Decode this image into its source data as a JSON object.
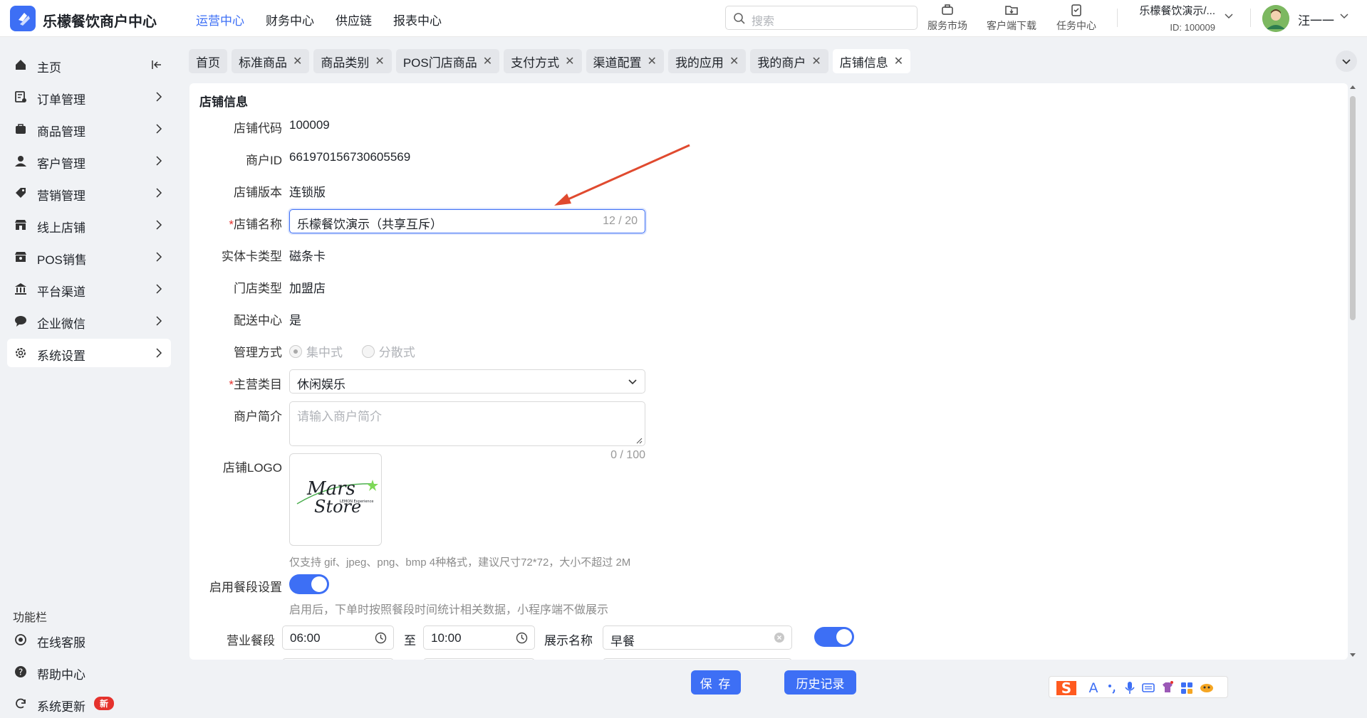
{
  "header": {
    "brand": "乐檬餐饮商户中心",
    "nav": [
      "运营中心",
      "财务中心",
      "供应链",
      "报表中心"
    ],
    "active_nav": 0,
    "search_placeholder": "搜索",
    "tools": [
      "服务市场",
      "客户端下载",
      "任务中心"
    ],
    "merchant_name": "乐檬餐饮演示/...",
    "merchant_id": "ID: 100009",
    "username": "汪一一"
  },
  "sidebar": {
    "items": [
      {
        "label": "主页",
        "icon": "home-icon"
      },
      {
        "label": "订单管理",
        "icon": "order-icon"
      },
      {
        "label": "商品管理",
        "icon": "goods-icon"
      },
      {
        "label": "客户管理",
        "icon": "user-icon"
      },
      {
        "label": "营销管理",
        "icon": "tag-icon"
      },
      {
        "label": "线上店铺",
        "icon": "store-icon"
      },
      {
        "label": "POS销售",
        "icon": "pos-icon"
      },
      {
        "label": "平台渠道",
        "icon": "bank-icon"
      },
      {
        "label": "企业微信",
        "icon": "chat-icon"
      },
      {
        "label": "系统设置",
        "icon": "gear-icon"
      }
    ],
    "active_index": 9,
    "func_title": "功能栏",
    "func_items": [
      {
        "label": "在线客服",
        "icon": "service-icon"
      },
      {
        "label": "帮助中心",
        "icon": "help-icon"
      },
      {
        "label": "系统更新",
        "icon": "refresh-icon",
        "badge": "新"
      }
    ]
  },
  "tabs": [
    {
      "label": "首页",
      "closable": false
    },
    {
      "label": "标准商品",
      "closable": true
    },
    {
      "label": "商品类别",
      "closable": true
    },
    {
      "label": "POS门店商品",
      "closable": true
    },
    {
      "label": "支付方式",
      "closable": true
    },
    {
      "label": "渠道配置",
      "closable": true
    },
    {
      "label": "我的应用",
      "closable": true
    },
    {
      "label": "我的商户",
      "closable": true
    },
    {
      "label": "店铺信息",
      "closable": true
    }
  ],
  "active_tab": 8,
  "form": {
    "title": "店铺信息",
    "store_code_label": "店铺代码",
    "store_code": "100009",
    "merchant_id_label": "商户ID",
    "merchant_id": "661970156730605569",
    "version_label": "店铺版本",
    "version": "连锁版",
    "store_name_label": "店铺名称",
    "store_name": "乐檬餐饮演示（共享互斥）",
    "store_name_count": "12 / 20",
    "card_type_label": "实体卡类型",
    "card_type": "磁条卡",
    "shop_type_label": "门店类型",
    "shop_type": "加盟店",
    "delivery_label": "配送中心",
    "delivery": "是",
    "manage_label": "管理方式",
    "manage_options": [
      "集中式",
      "分散式"
    ],
    "category_label": "主营类目",
    "category": "休闲娱乐",
    "intro_label": "商户简介",
    "intro_placeholder": "请输入商户简介",
    "intro_count": "0 / 100",
    "logo_label": "店铺LOGO",
    "logo_text_1": "Mars",
    "logo_text_2": "Store",
    "logo_text_3": "LEMON Experience",
    "logo_hint": "仅支持 gif、jpeg、png、bmp 4种格式，建议尺寸72*72，大小不超过 2M",
    "meal_label": "启用餐段设置",
    "meal_enabled": true,
    "meal_hint": "启用后，下单时按照餐段时间统计相关数据，小程序端不做展示",
    "period_label": "营业餐段",
    "period_start": "06:00",
    "period_to": "至",
    "period_end": "10:00",
    "display_name_label": "展示名称",
    "display_name": "早餐",
    "period_enabled": true
  },
  "footer": {
    "save": "保 存",
    "history": "历史记录"
  },
  "colors": {
    "accent": "#3d6ff5",
    "danger": "#e5322d",
    "annotation_arrow": "#e04a2f"
  }
}
